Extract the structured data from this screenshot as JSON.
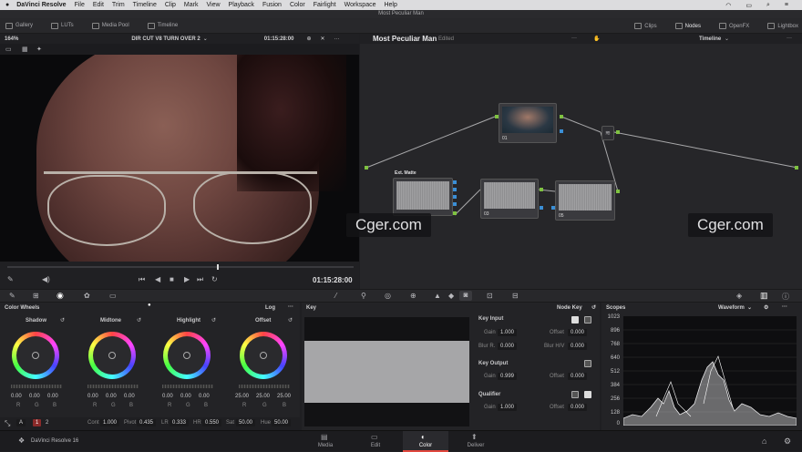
{
  "menubar": {
    "app": "DaVinci Resolve",
    "items": [
      "File",
      "Edit",
      "Trim",
      "Timeline",
      "Clip",
      "Mark",
      "View",
      "Playback",
      "Fusion",
      "Color",
      "Fairlight",
      "Workspace",
      "Help"
    ]
  },
  "window_title": "Most Peculiar Man",
  "toolbar": {
    "gallery": "Gallery",
    "luts": "LUTs",
    "media_pool": "Media Pool",
    "timeline": "Timeline",
    "clips": "Clips",
    "nodes": "Nodes",
    "openfx": "OpenFX",
    "lightbox": "Lightbox"
  },
  "viewer": {
    "zoom": "164%",
    "clip_name": "DIR CUT V8 TURN OVER 2",
    "timecode": "01:15:28:00",
    "playback_timecode": "01:15:28:00"
  },
  "nodes": {
    "project_title": "Most Peculiar Man",
    "edited_label": "Edited",
    "mode": "Timeline",
    "items": [
      {
        "label": "01"
      },
      {
        "label": "03"
      },
      {
        "label": "05"
      },
      {
        "label": "Ext. Matte"
      }
    ]
  },
  "watermark": "Cger.com",
  "color_wheels": {
    "title": "Color Wheels",
    "mode": "Log",
    "wheels": [
      {
        "name": "Shadow",
        "r": "0.00",
        "g": "0.00",
        "b": "0.00"
      },
      {
        "name": "Midtone",
        "r": "0.00",
        "g": "0.00",
        "b": "0.00"
      },
      {
        "name": "Highlight",
        "r": "0.00",
        "g": "0.00",
        "b": "0.00"
      },
      {
        "name": "Offset",
        "r": "25.00",
        "g": "25.00",
        "b": "25.00"
      }
    ],
    "channel_labels": [
      "R",
      "G",
      "B"
    ],
    "bottom": {
      "page1": "1",
      "page2": "2",
      "cont_label": "Cont",
      "cont": "1.000",
      "pivot_label": "Pivot",
      "pivot": "0.435",
      "lr_label": "LR",
      "lr": "0.333",
      "hr_label": "HR",
      "hr": "0.550",
      "sat_label": "Sat",
      "sat": "50.00",
      "hue_label": "Hue",
      "hue": "50.00"
    }
  },
  "key": {
    "title": "Key",
    "node_key": "Node Key",
    "key_input": "Key Input",
    "gain_label": "Gain",
    "gain": "1.000",
    "offset_label": "Offset",
    "offset": "0.000",
    "blur_r_label": "Blur R.",
    "blur_r": "0.000",
    "blur_hv_label": "Blur H/V",
    "blur_hv": "0.000",
    "key_output": "Key Output",
    "out_gain": "0.999",
    "out_offset": "0.000",
    "qualifier": "Qualifier",
    "q_gain": "1.000",
    "q_offset": "0.000"
  },
  "scopes": {
    "title": "Scopes",
    "mode": "Waveform",
    "ticks": [
      "1023",
      "896",
      "768",
      "640",
      "512",
      "384",
      "256",
      "128",
      "0"
    ]
  },
  "bottombar": {
    "app": "DaVinci Resolve 16",
    "pages": [
      "Media",
      "Edit",
      "Color",
      "Deliver"
    ]
  },
  "colors": {
    "accent": "#e0473e",
    "node_link": "#7fc241",
    "port_blue": "#3b8fd6"
  }
}
